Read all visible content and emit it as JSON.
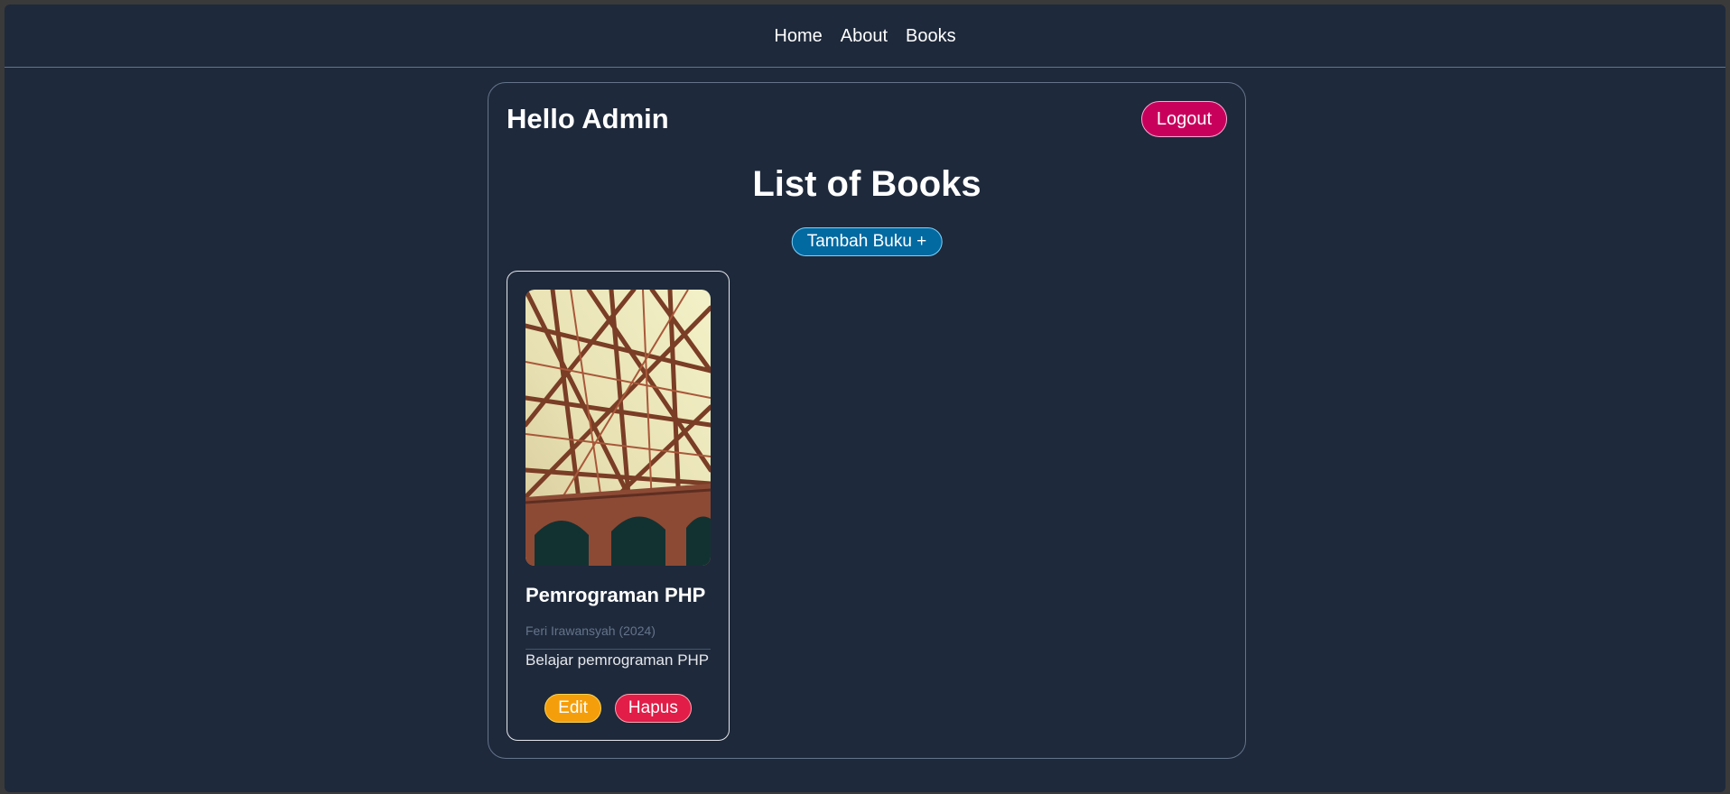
{
  "nav": {
    "items": [
      {
        "label": "Home"
      },
      {
        "label": "About"
      },
      {
        "label": "Books"
      }
    ]
  },
  "header": {
    "greeting": "Hello Admin",
    "logout_label": "Logout"
  },
  "main": {
    "title": "List of Books",
    "add_label": "Tambah Buku +"
  },
  "books": [
    {
      "title": "Pemrograman PHP",
      "author": "Feri Irawansyah",
      "year": "(2024)",
      "description": "Belajar pemrograman PHP",
      "edit_label": "Edit",
      "delete_label": "Hapus",
      "cover_icon": "bridge-photo"
    }
  ],
  "colors": {
    "background": "#1e293b",
    "logout": "#c8005c",
    "add": "#0369a1",
    "edit": "#f59e0b",
    "delete": "#e11d48"
  }
}
